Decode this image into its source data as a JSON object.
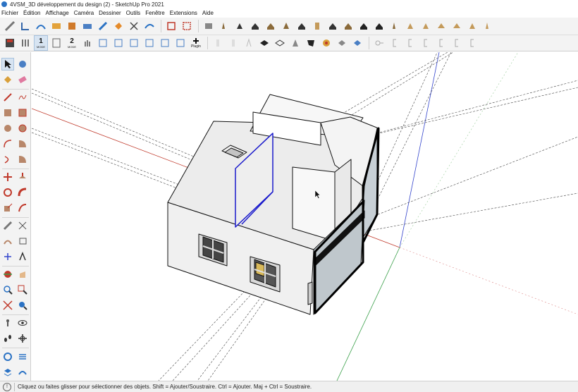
{
  "window": {
    "title": "4VSM_3D développement du design (2) - SketchUp Pro 2021"
  },
  "menu": [
    "Fichier",
    "Édition",
    "Affichage",
    "Caméra",
    "Dessiner",
    "Outils",
    "Fenêtre",
    "Extensions",
    "Aide"
  ],
  "toolbar2": {
    "mode1": {
      "num": "1",
      "label": "MODE"
    },
    "mode2": {
      "num": "2",
      "label": "MODE"
    },
    "plugin_label": "Plugin"
  },
  "status": {
    "text": "Cliquez ou faites glisser pour sélectionner des objets. Shift = Ajouter/Soustraire. Ctrl = Ajouter. Maj + Ctrl = Soustraire."
  },
  "colors": {
    "axis_red": "#c0392b",
    "axis_blue": "#3344cc",
    "axis_green": "#3aa04a",
    "selection": "#1a1acc",
    "toolbar_bg": "#f3f3f3"
  }
}
